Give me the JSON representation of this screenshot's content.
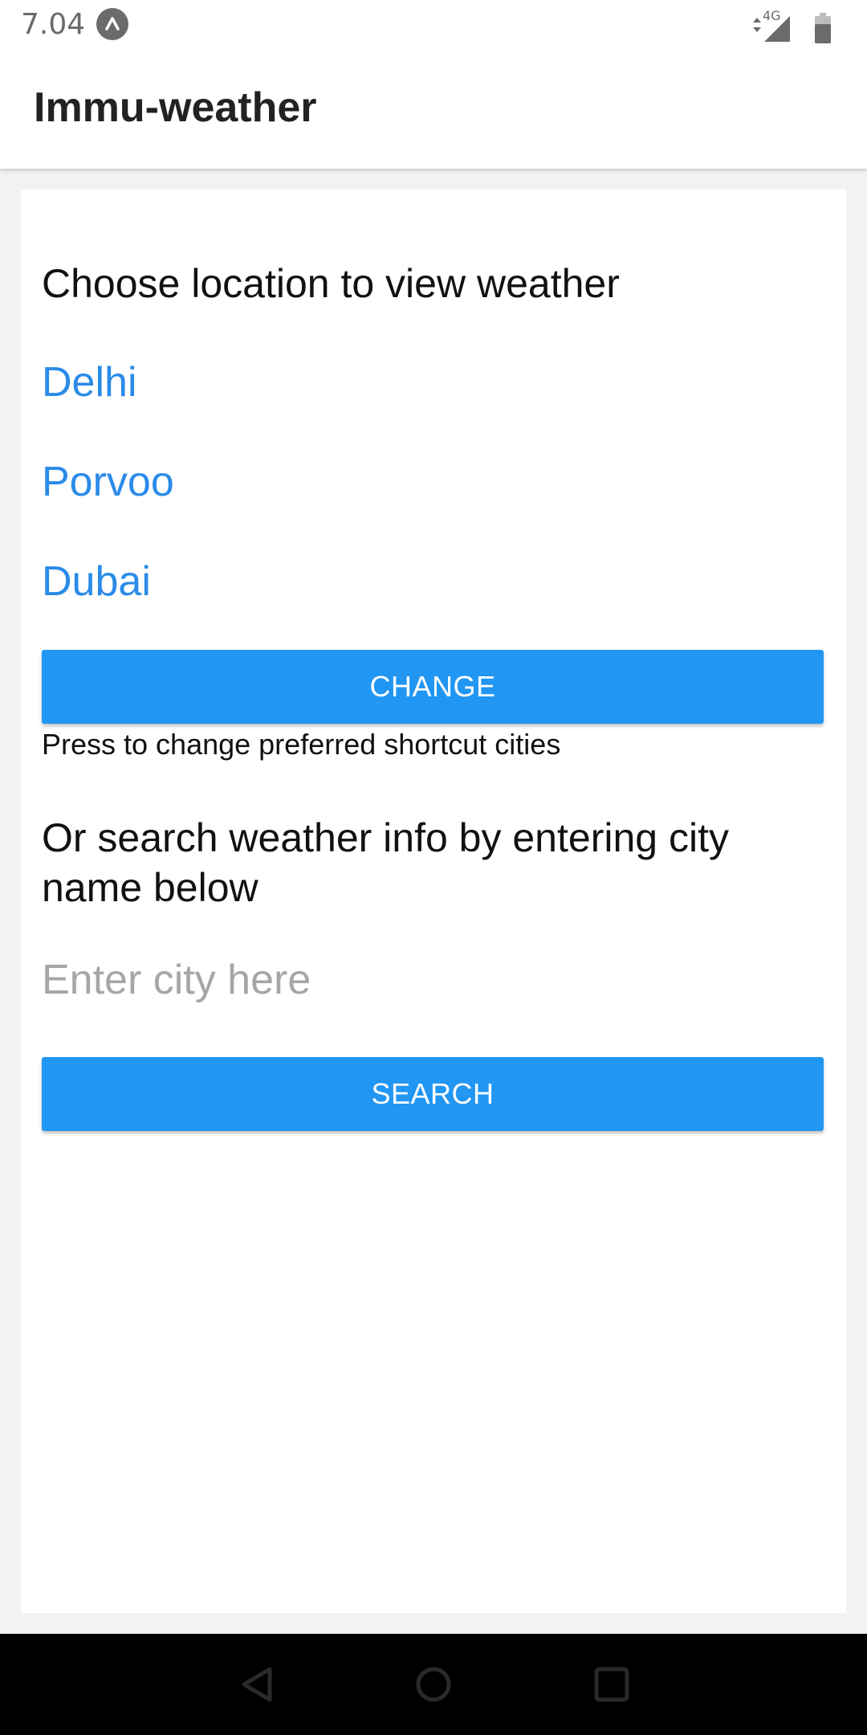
{
  "status_bar": {
    "time": "7.04",
    "network_label": "4G",
    "icons": [
      "app-notification-icon",
      "network-arrows-icon",
      "signal-icon",
      "battery-icon"
    ]
  },
  "app_bar": {
    "title": "Immu-weather"
  },
  "content": {
    "choose_heading": "Choose location to view weather",
    "cities": [
      "Delhi",
      "Porvoo",
      "Dubai"
    ],
    "change_button_label": "CHANGE",
    "change_hint": "Press to change preferred shortcut cities",
    "search_heading": "Or search weather info by entering city name below",
    "city_input": {
      "value": "",
      "placeholder": "Enter city here"
    },
    "search_button_label": "SEARCH"
  },
  "nav_bar": {
    "icons": [
      "back-icon",
      "home-icon",
      "recents-icon"
    ]
  },
  "colors": {
    "accent": "#2196f3",
    "link": "#2a8be8",
    "background": "#f2f2f2",
    "nav_bar": "#000000"
  }
}
